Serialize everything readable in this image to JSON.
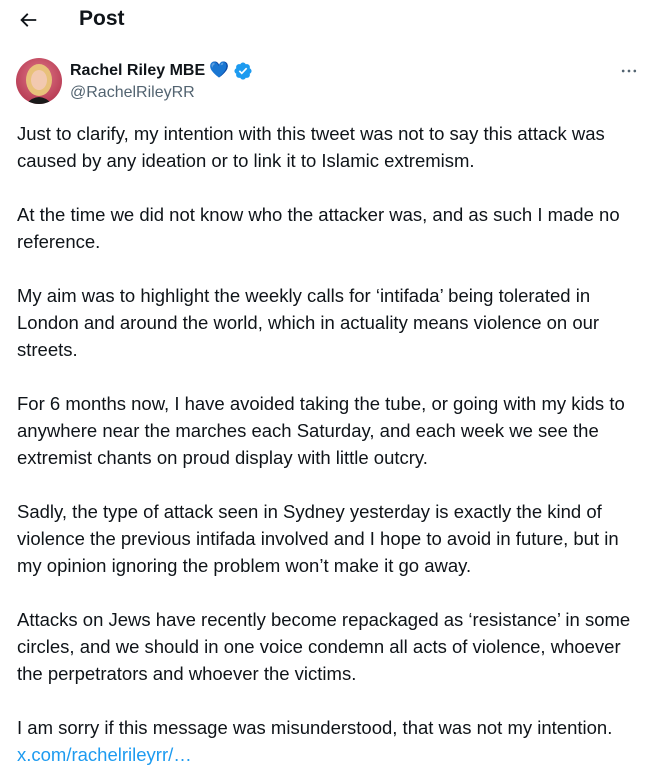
{
  "header": {
    "back_icon": "arrow-left-icon",
    "title": "Post"
  },
  "author": {
    "display_name": "Rachel Riley MBE",
    "handle": "@RachelRileyRR",
    "emoji": "💙",
    "verified_icon": "verified-badge-icon",
    "verified_color": "#1d9bf0"
  },
  "more_icon": "more-horizontal-icon",
  "tweet": {
    "paragraphs": [
      "Just to clarify, my intention with this tweet was not to say this attack was caused by any ideation or to link it to Islamic extremism.",
      "At the time we did not know who the attacker was, and as such I made no reference.",
      "My aim was to highlight the weekly calls for ‘intifada’ being tolerated in London and around the world, which in actuality means violence on our streets.",
      "For 6 months now, I have avoided taking the tube, or going with my kids to anywhere near the marches each Saturday, and each week we see the extremist chants on proud display with little outcry.",
      "Sadly, the type of attack seen in Sydney yesterday is exactly the kind of violence the previous intifada involved and I hope to avoid in future, but in my opinion ignoring the problem won’t make it go away.",
      "Attacks on Jews have recently become repackaged as ‘resistance’ in some circles, and we should in one voice condemn all acts of violence, whoever the perpetrators and whoever the victims.",
      "I am sorry if this message was misunderstood, that was not my intention."
    ],
    "link_text": "x.com/rachelrileyrr/…",
    "link_color": "#1d9bf0"
  }
}
